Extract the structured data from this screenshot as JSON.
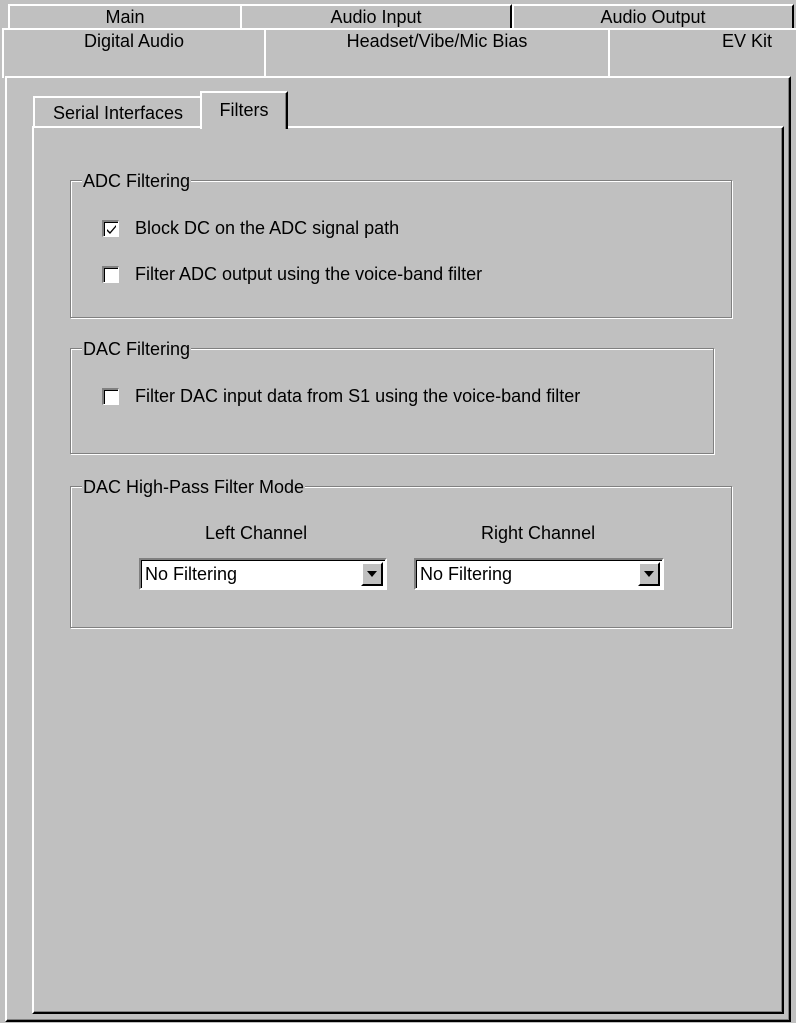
{
  "tabs_row1": [
    "Main",
    "Audio Input",
    "Audio Output"
  ],
  "tabs_row2": [
    "Digital Audio",
    "Headset/Vibe/Mic Bias",
    "EV Kit"
  ],
  "inner_tabs": [
    "Serial Interfaces",
    "Filters"
  ],
  "adc": {
    "title": "ADC Filtering",
    "block_dc": {
      "label": "Block DC on the ADC signal path",
      "checked": true
    },
    "voice_band": {
      "label": "Filter ADC output using the voice-band filter",
      "checked": false
    }
  },
  "dac": {
    "title": "DAC Filtering",
    "voice_band": {
      "label": "Filter DAC input data from S1 using the voice-band filter",
      "checked": false
    }
  },
  "hpf": {
    "title": "DAC High-Pass Filter Mode",
    "left_label": "Left Channel",
    "right_label": "Right Channel",
    "left_value": "No Filtering",
    "right_value": "No Filtering"
  },
  "icons": {
    "dropdown": "chevron-down-icon",
    "check": "check-icon"
  }
}
